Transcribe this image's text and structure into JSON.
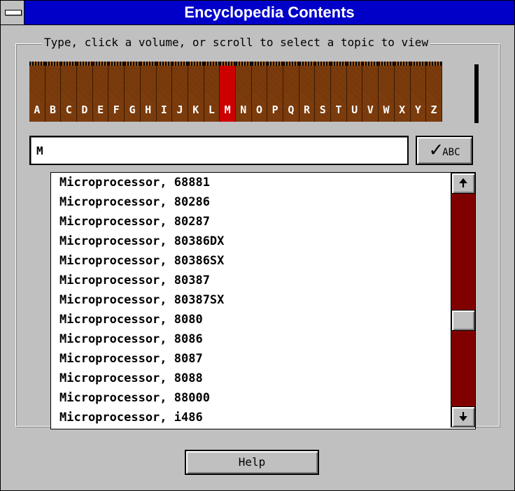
{
  "window": {
    "title": "Encyclopedia Contents"
  },
  "group": {
    "label": "Type, click a volume, or scroll to select a topic to view"
  },
  "volumes": [
    "A",
    "B",
    "C",
    "D",
    "E",
    "F",
    "G",
    "H",
    "I",
    "J",
    "K",
    "L",
    "M",
    "N",
    "O",
    "P",
    "Q",
    "R",
    "S",
    "T",
    "U",
    "V",
    "W",
    "X",
    "Y",
    "Z"
  ],
  "selected_volume": "M",
  "search": {
    "value": "M"
  },
  "check_button": {
    "glyph": "✓",
    "label": "ABC"
  },
  "topics": [
    "Microprocessor, 68881",
    "Microprocessor, 80286",
    "Microprocessor, 80287",
    "Microprocessor, 80386DX",
    "Microprocessor, 80386SX",
    "Microprocessor, 80387",
    "Microprocessor, 80387SX",
    "Microprocessor, 8080",
    "Microprocessor, 8086",
    "Microprocessor, 8087",
    "Microprocessor, 8088",
    "Microprocessor, 88000",
    "Microprocessor, i486"
  ],
  "scroll": {
    "up_glyph": "🠉",
    "down_glyph": "🠋"
  },
  "help_button": {
    "label": "Help"
  }
}
